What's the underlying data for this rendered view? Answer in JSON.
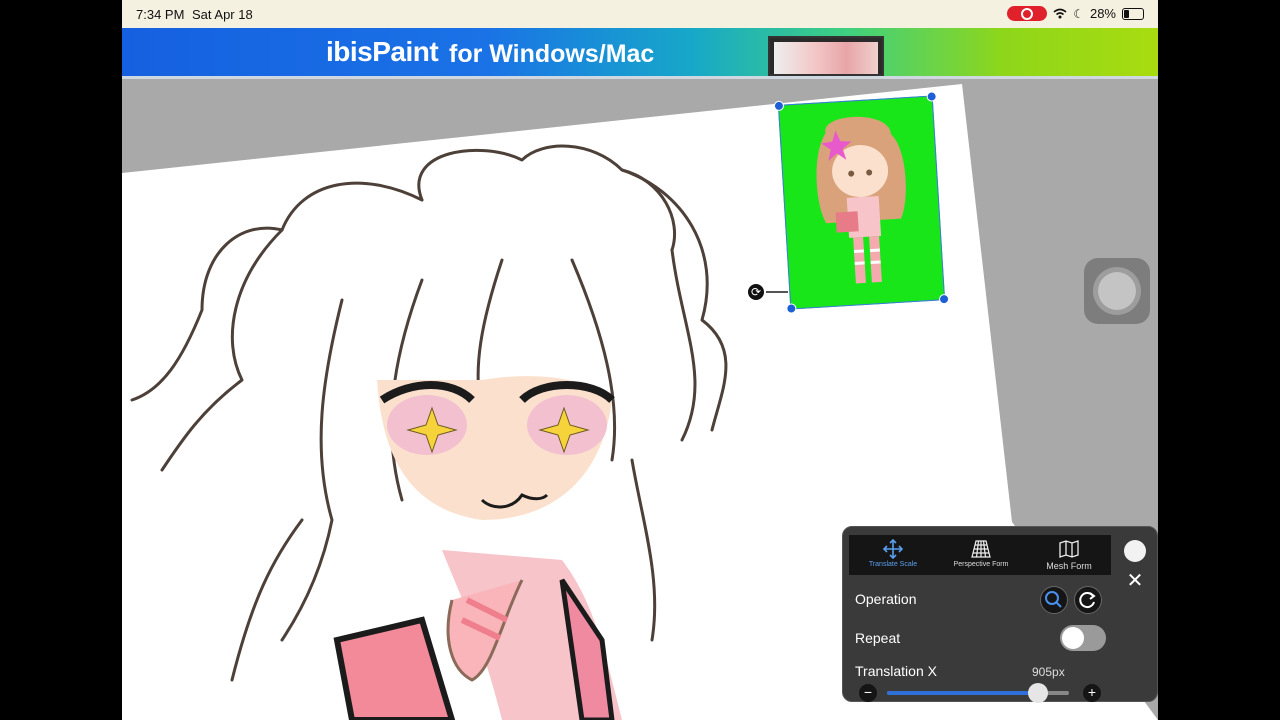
{
  "status_bar": {
    "time": "7:34 PM",
    "date": "Sat Apr 18",
    "battery": "28%"
  },
  "banner": {
    "logo": "ibisPaint",
    "text": "for Windows/Mac"
  },
  "canvas": {
    "layer_background_color": "#19e619"
  },
  "tool_panel": {
    "modes": [
      {
        "label": "Translate Scale",
        "icon": "move-arrows-icon",
        "active": true
      },
      {
        "label": "Perspective Form",
        "icon": "perspective-grid-icon",
        "active": false
      },
      {
        "label": "Mesh Form",
        "icon": "mesh-map-icon",
        "active": false
      }
    ],
    "operation_label": "Operation",
    "repeat_label": "Repeat",
    "repeat_on": false,
    "translation_x_label": "Translation X",
    "translation_x_value": "905px",
    "translation_x_fraction": 0.83
  },
  "colors": {
    "accent": "#2f6fd8",
    "panel": "#3a3a3a"
  }
}
